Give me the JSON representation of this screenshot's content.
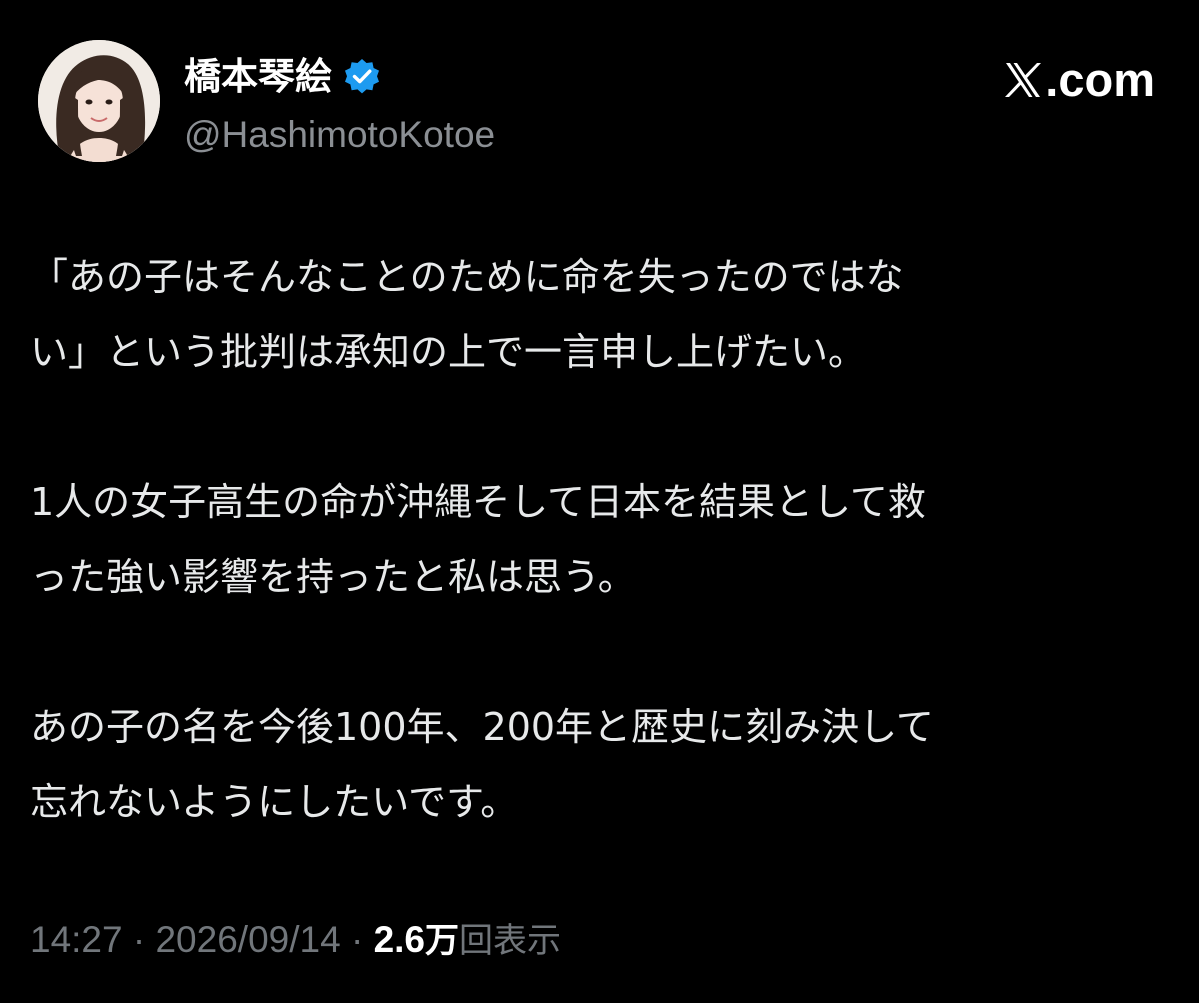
{
  "author": {
    "display_name": "橋本琴絵",
    "handle": "@HashimotoKotoe",
    "avatar_icon": "profile-photo-avatar",
    "verified_icon": "verified-badge-icon",
    "verified_color": "#1d9bf0"
  },
  "brand": {
    "site_text": "com",
    "logo_icon": "x-logo-icon",
    "logo_char": "𝕏",
    "dot": "."
  },
  "tweet": {
    "paragraphs": [
      {
        "lines": [
          "「あの子はそんなことのために命を失ったのではな",
          "い」という批判は承知の上で一言申し上げたい。"
        ]
      },
      {
        "lines": [
          "1人の女子高生の命が沖縄そして日本を結果として救",
          "った強い影響を持ったと私は思う。"
        ]
      },
      {
        "lines": [
          "あの子の名を今後100年、200年と歴史に刻み決して",
          "忘れないようにしたいです。"
        ]
      }
    ]
  },
  "meta": {
    "time": "14:27",
    "separator": " · ",
    "date": "2026/09/14",
    "views_count": "2.6",
    "views_unit": "万",
    "views_label": "回表示"
  },
  "colors": {
    "background": "#000000",
    "text": "#e7e9ea",
    "muted": "#71767b",
    "handle": "#8b8f94",
    "accent": "#1d9bf0"
  }
}
